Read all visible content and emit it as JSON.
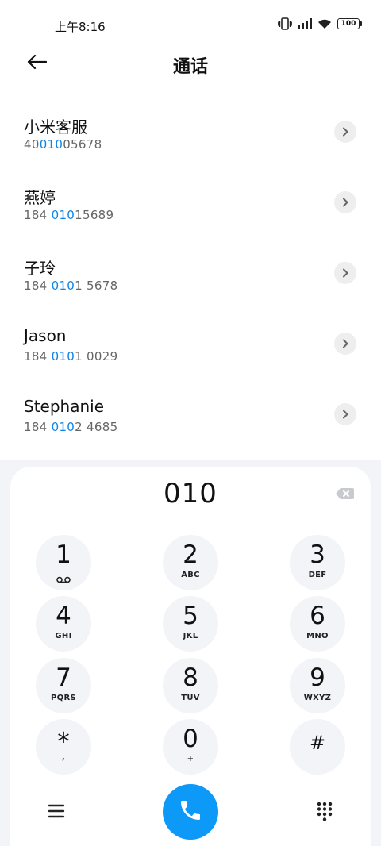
{
  "status_bar": {
    "time": "上午8:16",
    "battery": "100"
  },
  "header": {
    "title": "通话"
  },
  "contacts": [
    {
      "name": "小米客服",
      "number_pre": "40",
      "number_match": "010",
      "number_post": "05678"
    },
    {
      "name": "燕婷",
      "number_pre": "184 ",
      "number_match": "010",
      "number_post": "15689"
    },
    {
      "name": "子玲",
      "number_pre": "184 ",
      "number_match": "010",
      "number_post": "1 5678"
    },
    {
      "name": "Jason",
      "number_pre": "184 ",
      "number_match": "010",
      "number_post": "1 0029"
    },
    {
      "name": "Stephanie",
      "number_pre": "184 ",
      "number_match": "010",
      "number_post": "2 4685"
    }
  ],
  "dialer": {
    "input": "010",
    "keys": [
      {
        "digit": "1",
        "letters": ""
      },
      {
        "digit": "2",
        "letters": "ABC"
      },
      {
        "digit": "3",
        "letters": "DEF"
      },
      {
        "digit": "4",
        "letters": "GHI"
      },
      {
        "digit": "5",
        "letters": "JKL"
      },
      {
        "digit": "6",
        "letters": "MNO"
      },
      {
        "digit": "7",
        "letters": "PQRS"
      },
      {
        "digit": "8",
        "letters": "TUV"
      },
      {
        "digit": "9",
        "letters": "WXYZ"
      },
      {
        "digit": "*",
        "letters": ","
      },
      {
        "digit": "0",
        "letters": "+"
      },
      {
        "digit": "#",
        "letters": ""
      }
    ]
  },
  "colors": {
    "accent": "#0d99f7",
    "match_highlight": "#0e84e6",
    "key_background": "#f3f4f8"
  },
  "icons": {
    "back": "arrow-left-icon",
    "detail": "chevron-right-icon",
    "backspace": "backspace-icon",
    "voicemail": "voicemail-icon",
    "menu": "menu-icon",
    "call": "phone-icon",
    "dialpad": "dialpad-icon"
  }
}
